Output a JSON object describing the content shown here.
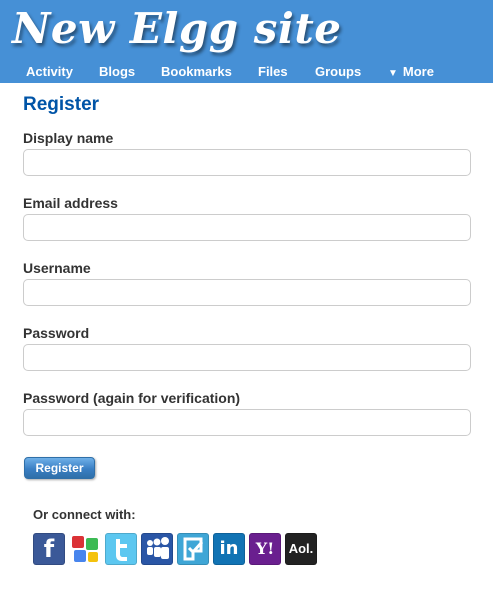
{
  "header": {
    "site_title": "New Elgg site",
    "nav": {
      "activity": "Activity",
      "blogs": "Blogs",
      "bookmarks": "Bookmarks",
      "files": "Files",
      "groups": "Groups",
      "more": "More"
    }
  },
  "form": {
    "heading": "Register",
    "display_name_label": "Display name",
    "email_label": "Email address",
    "username_label": "Username",
    "password_label": "Password",
    "password2_label": "Password (again for verification)",
    "register_button": "Register"
  },
  "social": {
    "label": "Or connect with:",
    "providers": {
      "facebook": {
        "icon": "facebook-icon",
        "glyph": "f",
        "color": "#3b5998"
      },
      "google": {
        "icon": "google-icon",
        "color": "#ffffff"
      },
      "twitter": {
        "icon": "twitter-icon",
        "color": "#5cc7f0"
      },
      "myspace": {
        "icon": "myspace-icon",
        "color": "#2a56a6"
      },
      "foursquare": {
        "icon": "foursquare-icon",
        "color": "#3fa6d6"
      },
      "linkedin": {
        "icon": "linkedin-icon",
        "glyph": "in",
        "color": "#1173b4"
      },
      "yahoo": {
        "icon": "yahoo-icon",
        "glyph": "Y!",
        "color": "#6a1f8f"
      },
      "aol": {
        "icon": "aol-icon",
        "glyph": "Aol.",
        "color": "#222222"
      }
    }
  },
  "colors": {
    "header_bg": "#4690d6",
    "heading": "#0054a7",
    "label": "#333333"
  }
}
